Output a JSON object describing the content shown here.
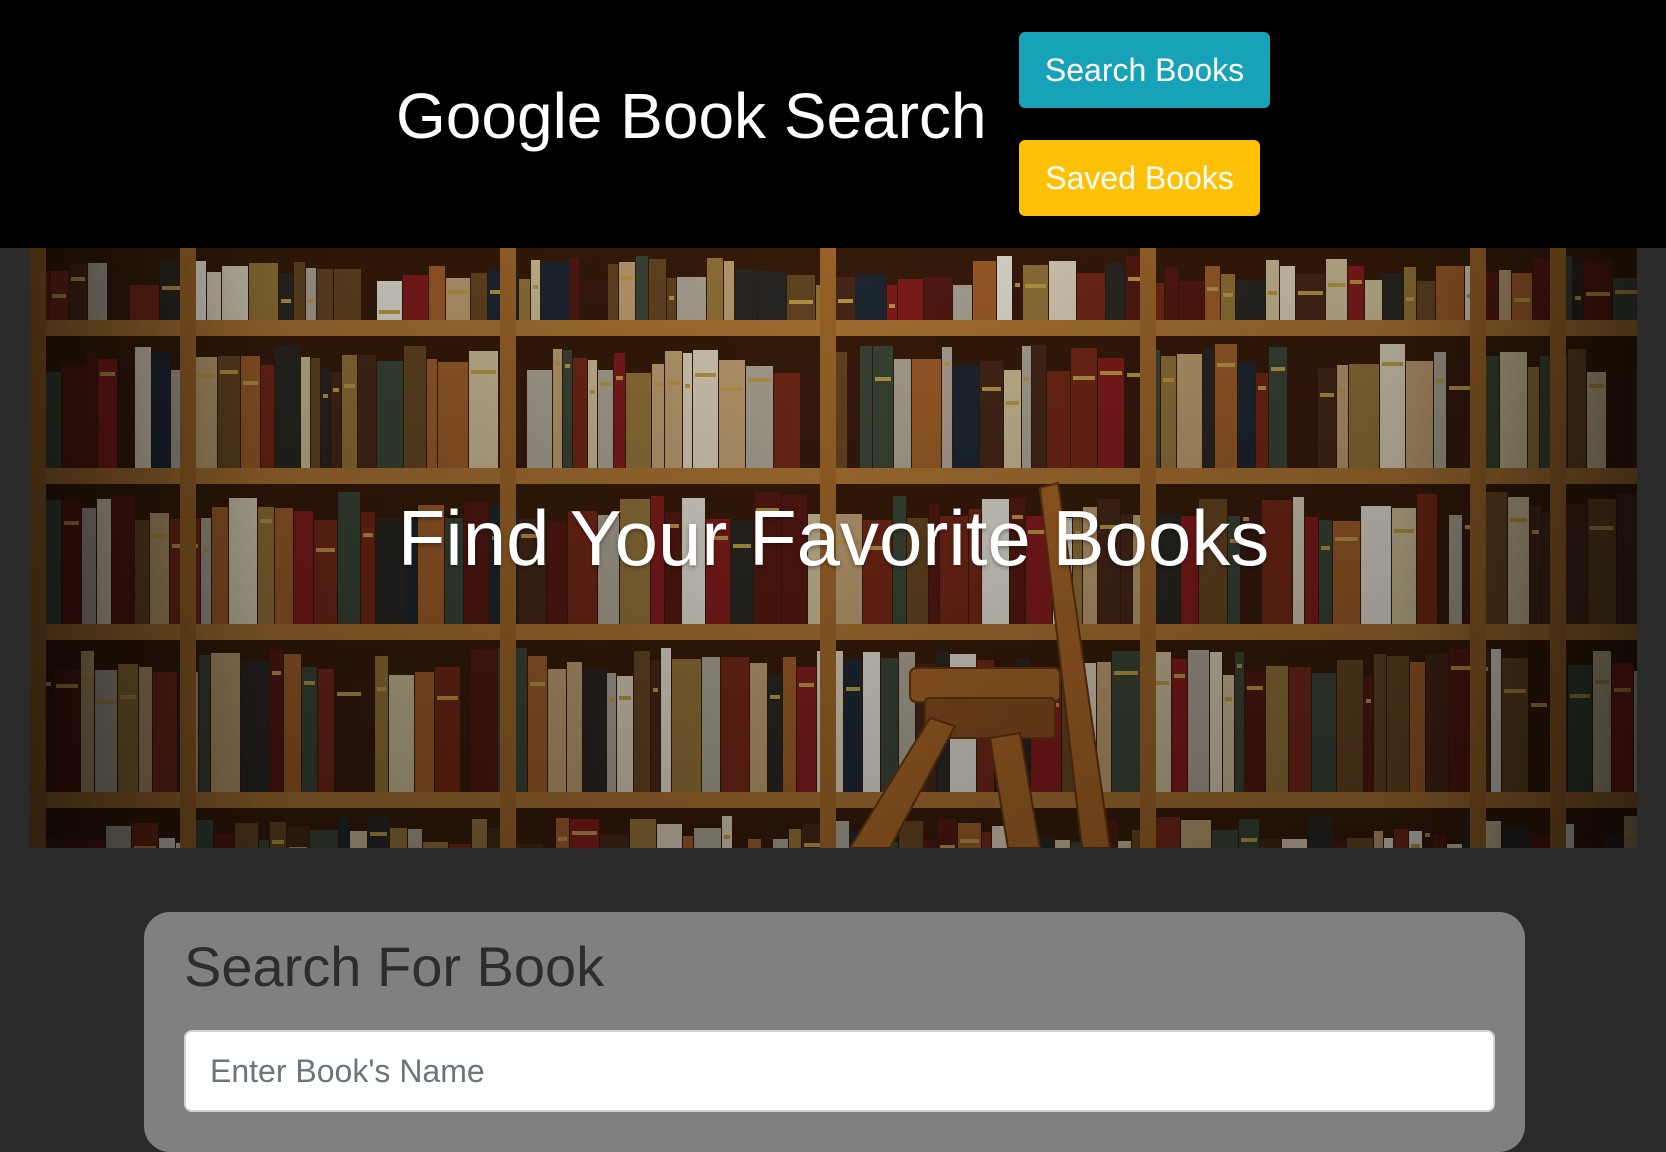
{
  "header": {
    "title": "Google Book Search",
    "search_button_label": "Search Books",
    "saved_button_label": "Saved Books"
  },
  "hero": {
    "title": "Find Your Favorite Books"
  },
  "search": {
    "heading": "Search For Book",
    "placeholder": "Enter Book's Name",
    "value": ""
  },
  "colors": {
    "navbar": "#000000",
    "page_background": "#2b2b2b",
    "search_button": "#17a2b8",
    "saved_button": "#ffc107",
    "search_card": "#808080"
  }
}
